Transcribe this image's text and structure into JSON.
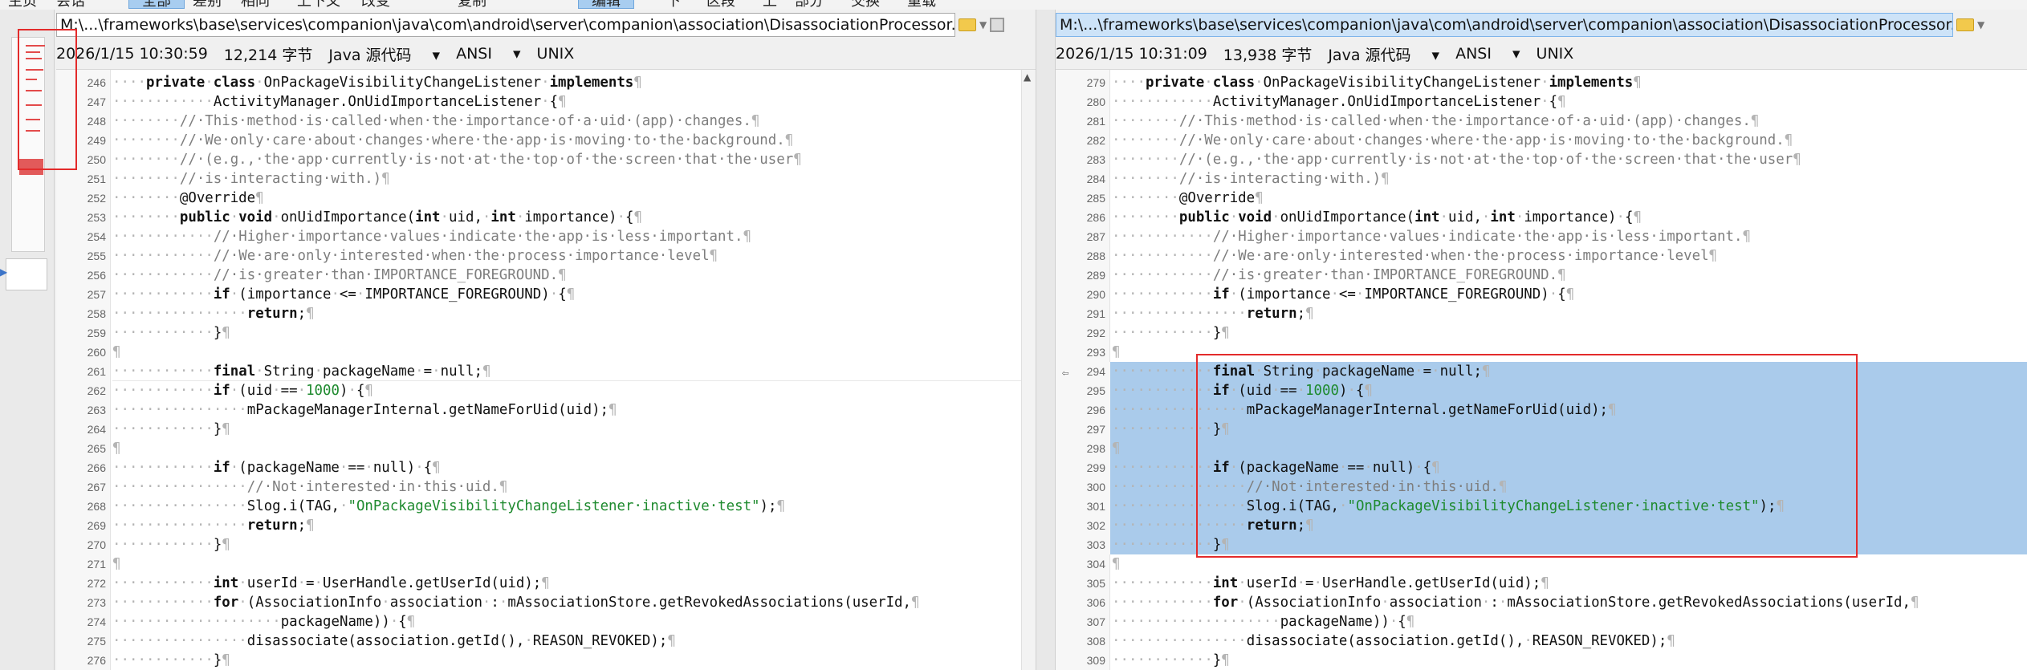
{
  "toolbar": {
    "items": [
      "主页",
      "会话",
      "全部",
      "差别",
      "相同",
      "上下文",
      "改变",
      "复制",
      "编辑",
      "下",
      "区段",
      "上",
      "部分",
      "交换",
      "重载"
    ],
    "active_index": 2,
    "edit_index": 8
  },
  "left": {
    "path": "M:\\...\\frameworks\\base\\services\\companion\\java\\com\\android\\server\\companion\\association\\DisassociationProcessor.java",
    "date": "2026/1/15 10:30:59",
    "size": "12,214 字节",
    "format": "Java 源代码",
    "encoding": "ANSI",
    "line_end": "UNIX",
    "cursor_line": "261",
    "lines": [
      {
        "n": "246",
        "t": "    private class OnPackageVisibilityChangeListener implements"
      },
      {
        "n": "247",
        "t": "            ActivityManager.OnUidImportanceListener {"
      },
      {
        "n": "248",
        "t": "        // This method is called when the importance of a uid (app) changes."
      },
      {
        "n": "249",
        "t": "        // We only care about changes where the app is moving to the background."
      },
      {
        "n": "250",
        "t": "        // (e.g., the app currently is not at the top of the screen that the user"
      },
      {
        "n": "251",
        "t": "        // is interacting with.)"
      },
      {
        "n": "252",
        "t": "        @Override"
      },
      {
        "n": "253",
        "t": "        public void onUidImportance(int uid, int importance) {"
      },
      {
        "n": "254",
        "t": "            // Higher importance values indicate the app is less important."
      },
      {
        "n": "255",
        "t": "            // We are only interested when the process importance level"
      },
      {
        "n": "256",
        "t": "            // is greater than IMPORTANCE_FOREGROUND."
      },
      {
        "n": "257",
        "t": "            if (importance <= IMPORTANCE_FOREGROUND) {"
      },
      {
        "n": "258",
        "t": "                return;"
      },
      {
        "n": "259",
        "t": "            }"
      },
      {
        "n": "260",
        "t": ""
      },
      {
        "n": "261",
        "t": "            final String packageName = null;"
      },
      {
        "n": "262",
        "t": "            if (uid == 1000) {"
      },
      {
        "n": "263",
        "t": "                mPackageManagerInternal.getNameForUid(uid);"
      },
      {
        "n": "264",
        "t": "            }"
      },
      {
        "n": "265",
        "t": ""
      },
      {
        "n": "266",
        "t": "            if (packageName == null) {"
      },
      {
        "n": "267",
        "t": "                // Not interested in this uid."
      },
      {
        "n": "268",
        "t": "                Slog.i(TAG, \"OnPackageVisibilityChangeListener inactive test\");"
      },
      {
        "n": "269",
        "t": "                return;"
      },
      {
        "n": "270",
        "t": "            }"
      },
      {
        "n": "271",
        "t": ""
      },
      {
        "n": "272",
        "t": "            int userId = UserHandle.getUserId(uid);"
      },
      {
        "n": "273",
        "t": "            for (AssociationInfo association : mAssociationStore.getRevokedAssociations(userId,"
      },
      {
        "n": "274",
        "t": "                    packageName)) {"
      },
      {
        "n": "275",
        "t": "                disassociate(association.getId(), REASON_REVOKED);"
      },
      {
        "n": "276",
        "t": "            }"
      }
    ]
  },
  "right": {
    "path": "M:\\...\\frameworks\\base\\services\\companion\\java\\com\\android\\server\\companion\\association\\DisassociationProcessor.java",
    "date": "2026/1/15 10:31:09",
    "size": "13,938 字节",
    "format": "Java 源代码",
    "encoding": "ANSI",
    "line_end": "UNIX",
    "diff_marker": "⇦",
    "lines": [
      {
        "n": "279",
        "t": "    private class OnPackageVisibilityChangeListener implements"
      },
      {
        "n": "280",
        "t": "            ActivityManager.OnUidImportanceListener {"
      },
      {
        "n": "281",
        "t": "        // This method is called when the importance of a uid (app) changes."
      },
      {
        "n": "282",
        "t": "        // We only care about changes where the app is moving to the background."
      },
      {
        "n": "283",
        "t": "        // (e.g., the app currently is not at the top of the screen that the user"
      },
      {
        "n": "284",
        "t": "        // is interacting with.)"
      },
      {
        "n": "285",
        "t": "        @Override"
      },
      {
        "n": "286",
        "t": "        public void onUidImportance(int uid, int importance) {"
      },
      {
        "n": "287",
        "t": "            // Higher importance values indicate the app is less important."
      },
      {
        "n": "288",
        "t": "            // We are only interested when the process importance level"
      },
      {
        "n": "289",
        "t": "            // is greater than IMPORTANCE_FOREGROUND."
      },
      {
        "n": "290",
        "t": "            if (importance <= IMPORTANCE_FOREGROUND) {"
      },
      {
        "n": "291",
        "t": "                return;"
      },
      {
        "n": "292",
        "t": "            }"
      },
      {
        "n": "293",
        "t": ""
      },
      {
        "n": "294",
        "t": "            final String packageName = null;",
        "sel": true
      },
      {
        "n": "295",
        "t": "            if (uid == 1000) {",
        "sel": true
      },
      {
        "n": "296",
        "t": "                mPackageManagerInternal.getNameForUid(uid);",
        "sel": true
      },
      {
        "n": "297",
        "t": "            }",
        "sel": true
      },
      {
        "n": "298",
        "t": "",
        "sel": true
      },
      {
        "n": "299",
        "t": "            if (packageName == null) {",
        "sel": true
      },
      {
        "n": "300",
        "t": "                // Not interested in this uid.",
        "sel": true
      },
      {
        "n": "301",
        "t": "                Slog.i(TAG, \"OnPackageVisibilityChangeListener inactive test\");",
        "sel": true
      },
      {
        "n": "302",
        "t": "                return;",
        "sel": true
      },
      {
        "n": "303",
        "t": "            }",
        "sel": true
      },
      {
        "n": "304",
        "t": ""
      },
      {
        "n": "305",
        "t": "            int userId = UserHandle.getUserId(uid);"
      },
      {
        "n": "306",
        "t": "            for (AssociationInfo association : mAssociationStore.getRevokedAssociations(userId,"
      },
      {
        "n": "307",
        "t": "                    packageName)) {"
      },
      {
        "n": "308",
        "t": "                disassociate(association.getId(), REASON_REVOKED);"
      },
      {
        "n": "309",
        "t": "            }"
      }
    ]
  },
  "colors": {
    "selection": "#aacbeb",
    "diff_red": "#e32b2b",
    "string_green": "#1e8a2e",
    "comment_gray": "#7e7e7e"
  }
}
